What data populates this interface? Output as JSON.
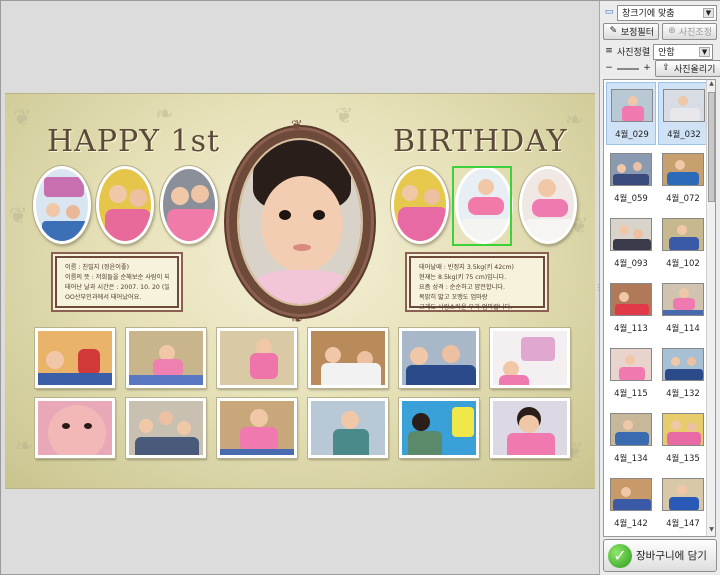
{
  "album": {
    "title_left": "HAPPY 1st",
    "title_right": "BIRTHDAY",
    "info_left": [
      "이름 : 친밀지 (정윤이좋)",
      "이름의 뜻 : 저희들을 순해보순 사람이 되어라는 뜻",
      "태어난 날과 시간은 : 2007. 10. 20 (일). 새벽 4시",
      "OO산부인과에서 태어났어요."
    ],
    "info_right": [
      "태어날때 : 빈정지 3.5kg(키 42cm)",
      "현재는 8.5kg(키 75 cm)입니다.",
      "요즘 성격 : 순순하고 얌전합니다.",
      "목밝히 밟고 꼬맹도 엄마랑",
      "그래도 사랑스러운 우리 엄마랍니다."
    ]
  },
  "panel": {
    "fit_select": "창크기에 맞춤",
    "filter_button": "보정필터",
    "adjust_button": "사진조정",
    "sort_label": "사진정렬",
    "sort_select": "안함",
    "upload_button": "사진올리기",
    "thumbnails": [
      "4월_029",
      "4월_032",
      "4월_059",
      "4월_072",
      "4월_093",
      "4월_102",
      "4월_113",
      "4월_114",
      "4월_115",
      "4월_132",
      "4월_134",
      "4월_135",
      "4월_142",
      "4월_147"
    ],
    "cart_button": "장바구니에 담기"
  },
  "colors": {
    "frame_brown": "#6e4a3a",
    "selection_green": "#3cd23c",
    "thumb_highlight": "#cfe2f6"
  }
}
